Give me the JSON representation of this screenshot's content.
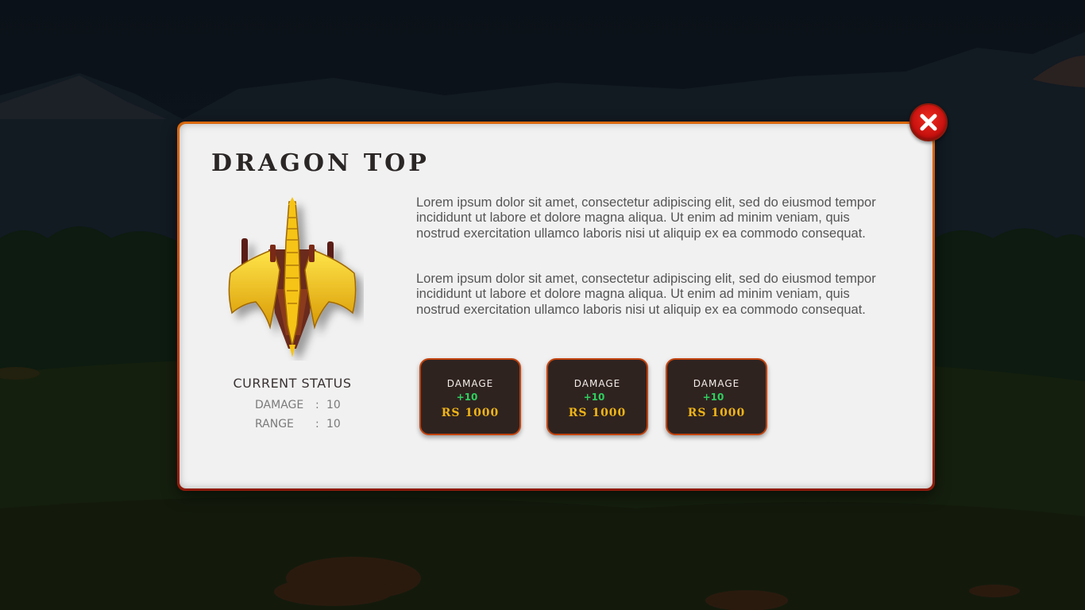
{
  "popup": {
    "title": "DRAGON TOP",
    "close_icon": "close-icon",
    "item_icon": "dragon-top-icon"
  },
  "status": {
    "heading": "CURRENT STATUS",
    "rows": [
      {
        "label": "DAMAGE",
        "sep": ":",
        "value": "10"
      },
      {
        "label": "RANGE",
        "sep": ":",
        "value": "10"
      }
    ]
  },
  "description": [
    "Lorem ipsum dolor sit amet, consectetur adipiscing elit, sed do eiusmod tempor incididunt ut labore et dolore magna aliqua. Ut enim ad minim veniam, quis nostrud exercitation ullamco laboris nisi ut aliquip ex ea commodo consequat.",
    "Lorem ipsum dolor sit amet, consectetur adipiscing elit, sed do eiusmod tempor incididunt ut labore et dolore magna aliqua. Ut enim ad minim veniam, quis nostrud exercitation ullamco laboris nisi ut aliquip ex ea commodo consequat."
  ],
  "upgrades": [
    {
      "label": "DAMAGE",
      "bonus": "+10",
      "price": "RS 1000"
    },
    {
      "label": "DAMAGE",
      "bonus": "+10",
      "price": "RS 1000"
    },
    {
      "label": "DAMAGE",
      "bonus": "+10",
      "price": "RS 1000"
    }
  ],
  "colors": {
    "panel_border": "#c2430f",
    "panel_fill": "#f1f1f1",
    "card_fill": "#2f2320",
    "bonus_green": "#2fcf5f",
    "price_gold": "#f0b516",
    "close_red": "#d3160f"
  }
}
